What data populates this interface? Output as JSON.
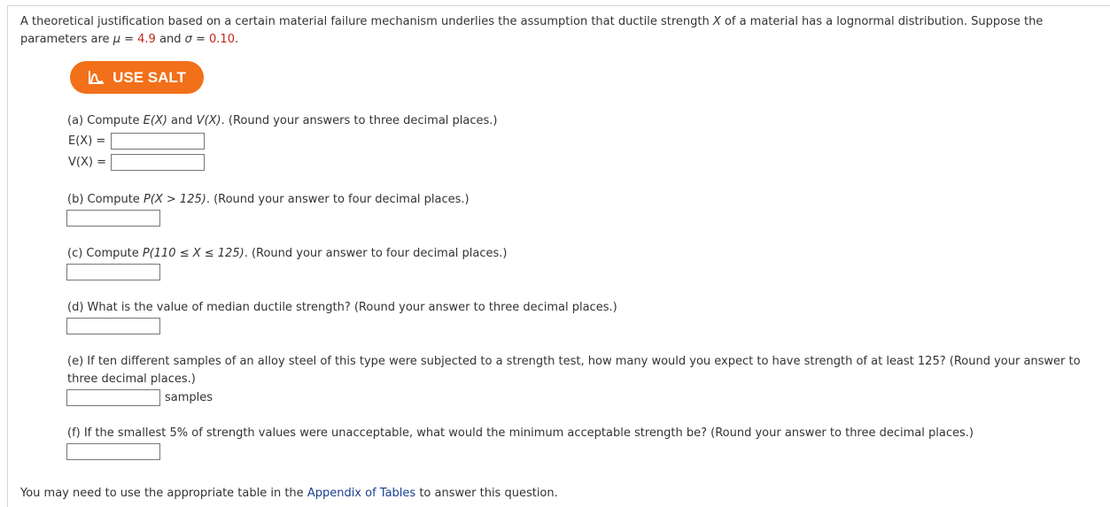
{
  "intro": {
    "line_prefix": "A theoretical justification based on a certain material failure mechanism underlies the assumption that ductile strength",
    "var_x": "X",
    "line_suffix": "of a material has a lognormal distribution. Suppose the parameters are",
    "mu_symbol": "μ",
    "mu_eq": " = ",
    "mu_value": "4.9",
    "and": "and",
    "sigma_symbol": "σ",
    "sigma_eq": " = ",
    "sigma_value": "0.10",
    "end": "."
  },
  "salt_button": {
    "label": "USE SALT",
    "icon": "salt-chart-icon",
    "color": "#f2701a"
  },
  "parts": {
    "a": {
      "prefix": "(a) Compute ",
      "ex": "E(X)",
      "and": " and ",
      "vx": "V(X)",
      "suffix": ". (Round your answers to three decimal places.)",
      "ex_label": "E(X) =",
      "vx_label": "V(X) =",
      "ex_value": "",
      "vx_value": ""
    },
    "b": {
      "prefix": "(b) Compute ",
      "expr": "P(X > 125)",
      "suffix": ". (Round your answer to four decimal places.)",
      "value": ""
    },
    "c": {
      "prefix": "(c) Compute ",
      "expr": "P(110 ≤ X ≤ 125)",
      "suffix": ". (Round your answer to four decimal places.)",
      "value": ""
    },
    "d": {
      "text": "(d) What is the value of median ductile strength? (Round your answer to three decimal places.)",
      "value": ""
    },
    "e": {
      "text": "(e) If ten different samples of an alloy steel of this type were subjected to a strength test, how many would you expect to have strength of at least 125? (Round your answer to three decimal places.)",
      "unit": "samples",
      "value": ""
    },
    "f": {
      "text": "(f) If the smallest 5% of strength values were unacceptable, what would the minimum acceptable strength be? (Round your answer to three decimal places.)",
      "value": ""
    }
  },
  "footer": {
    "prefix": "You may need to use the appropriate table in the ",
    "link": "Appendix of Tables",
    "suffix": " to answer this question."
  },
  "colors": {
    "value_red": "#c0271a",
    "link_blue": "#1a3e8f"
  }
}
